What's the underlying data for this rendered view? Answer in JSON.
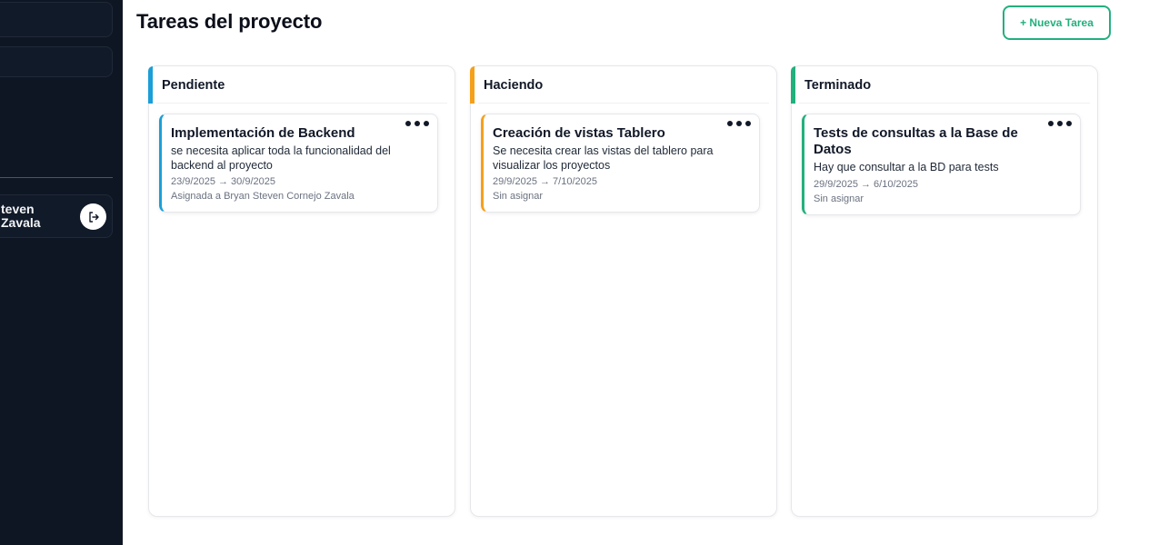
{
  "sidebar": {
    "user": {
      "name": "teven\nZavala"
    }
  },
  "header": {
    "title": "Tareas del proyecto",
    "new_task_label": "+ Nueva Tarea"
  },
  "columns": [
    {
      "title": "Pendiente",
      "accent": "#1a9fd8",
      "cards": [
        {
          "title": "Implementación de Backend",
          "description": "se necesita aplicar toda la funcionalidad del backend al proyecto",
          "dates": "23/9/2025 → 30/9/2025",
          "assignee": "Asignada a Bryan Steven Cornejo Zavala"
        }
      ]
    },
    {
      "title": "Haciendo",
      "accent": "#f5a01a",
      "cards": [
        {
          "title": "Creación de vistas Tablero",
          "description": "Se necesita crear las vistas del tablero para visualizar los proyectos",
          "dates": "29/9/2025 → 7/10/2025",
          "assignee": "Sin asignar"
        }
      ]
    },
    {
      "title": "Terminado",
      "accent": "#22b07d",
      "cards": [
        {
          "title": "Tests de consultas a la Base de Datos",
          "description": "Hay que consultar a la BD para tests",
          "dates": "29/9/2025 → 6/10/2025",
          "assignee": "Sin asignar"
        }
      ]
    }
  ],
  "colors": {
    "sidebar_bg": "#0f1623",
    "primary": "#22b07d"
  },
  "icons": {
    "logout": "logout-icon",
    "card_menu": "more-horizontal-icon"
  }
}
